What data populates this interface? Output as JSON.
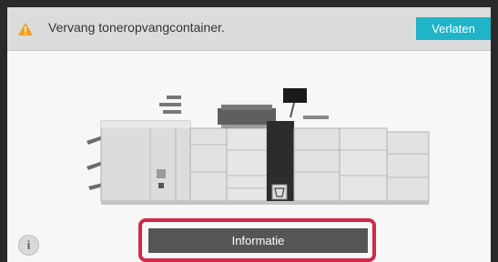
{
  "header": {
    "warning_icon": "warning-triangle-icon",
    "message": "Vervang toneropvangcontainer.",
    "exit_label": "Verlaten",
    "accent_color": "#1fb4c8"
  },
  "main": {
    "illustration": "printer-machine-illustration",
    "info_icon_glyph": "i",
    "info_button_label": "Informatie",
    "highlight_color": "#d3284a"
  }
}
